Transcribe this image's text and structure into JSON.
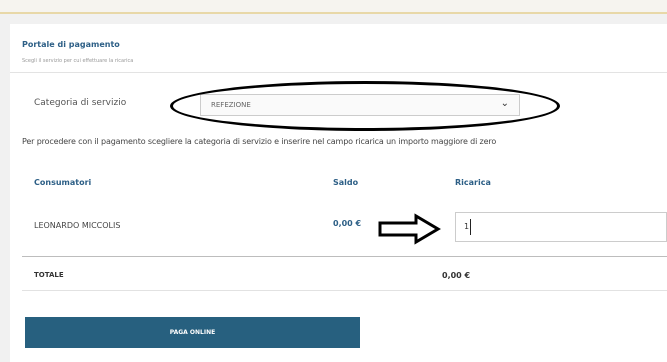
{
  "header": {
    "title": "Portale di pagamento",
    "subtitle": "Scegli il servizio per cui effettuare la ricarica"
  },
  "service": {
    "label": "Categoria di servizio",
    "selected": "REFEZIONE"
  },
  "instructions": "Per procedere con il pagamento scegliere la categoria di servizio e inserire nel campo ricarica un importo maggiore di zero",
  "table": {
    "columns": [
      "Consumatori",
      "Saldo",
      "Ricarica"
    ],
    "rows": [
      {
        "name": "LEONARDO MICCOLIS",
        "saldo": "0,00 €",
        "ricarica": "1"
      }
    ]
  },
  "total": {
    "label": "TOTALE",
    "value": "0,00 €"
  },
  "button": {
    "pay_label": "PAGA ONLINE"
  },
  "colors": {
    "accent": "#2d5f86",
    "button": "#27607f"
  }
}
